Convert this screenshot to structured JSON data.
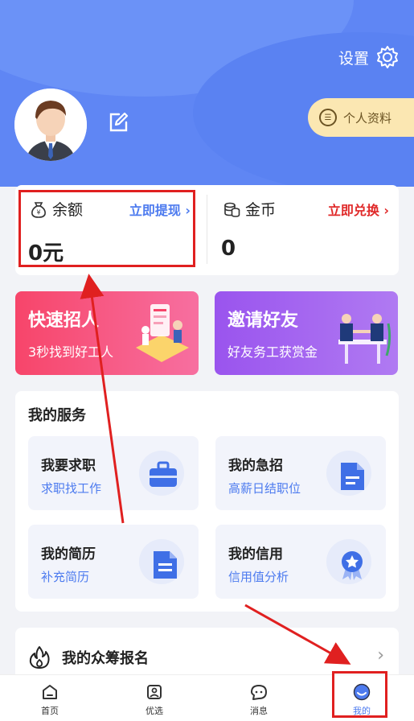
{
  "header": {
    "settings_label": "设置",
    "profile_label": "个人资料",
    "bg_color": "#5f86f4"
  },
  "wallet": {
    "balance": {
      "label": "余额",
      "action": "立即提现",
      "value": "0元"
    },
    "coins": {
      "label": "金币",
      "action": "立即兑换",
      "value": "0"
    }
  },
  "promos": [
    {
      "title": "快速招人",
      "subtitle": "3秒找到好工人"
    },
    {
      "title": "邀请好友",
      "subtitle": "好友务工获赏金"
    }
  ],
  "services": {
    "title": "我的服务",
    "items": [
      {
        "name": "我要求职",
        "desc": "求职找工作",
        "icon": "briefcase-icon"
      },
      {
        "name": "我的急招",
        "desc": "高薪日结职位",
        "icon": "document-icon"
      },
      {
        "name": "我的简历",
        "desc": "补充简历",
        "icon": "resume-icon"
      },
      {
        "name": "我的信用",
        "desc": "信用值分析",
        "icon": "badge-icon"
      }
    ]
  },
  "crowdfunding": {
    "label": "我的众筹报名"
  },
  "tabbar": {
    "items": [
      {
        "label": "首页",
        "icon": "home-icon"
      },
      {
        "label": "优选",
        "icon": "selection-icon"
      },
      {
        "label": "消息",
        "icon": "message-icon"
      },
      {
        "label": "我的",
        "icon": "profile-icon",
        "active": true
      }
    ],
    "active_color": "#4d7bef"
  }
}
